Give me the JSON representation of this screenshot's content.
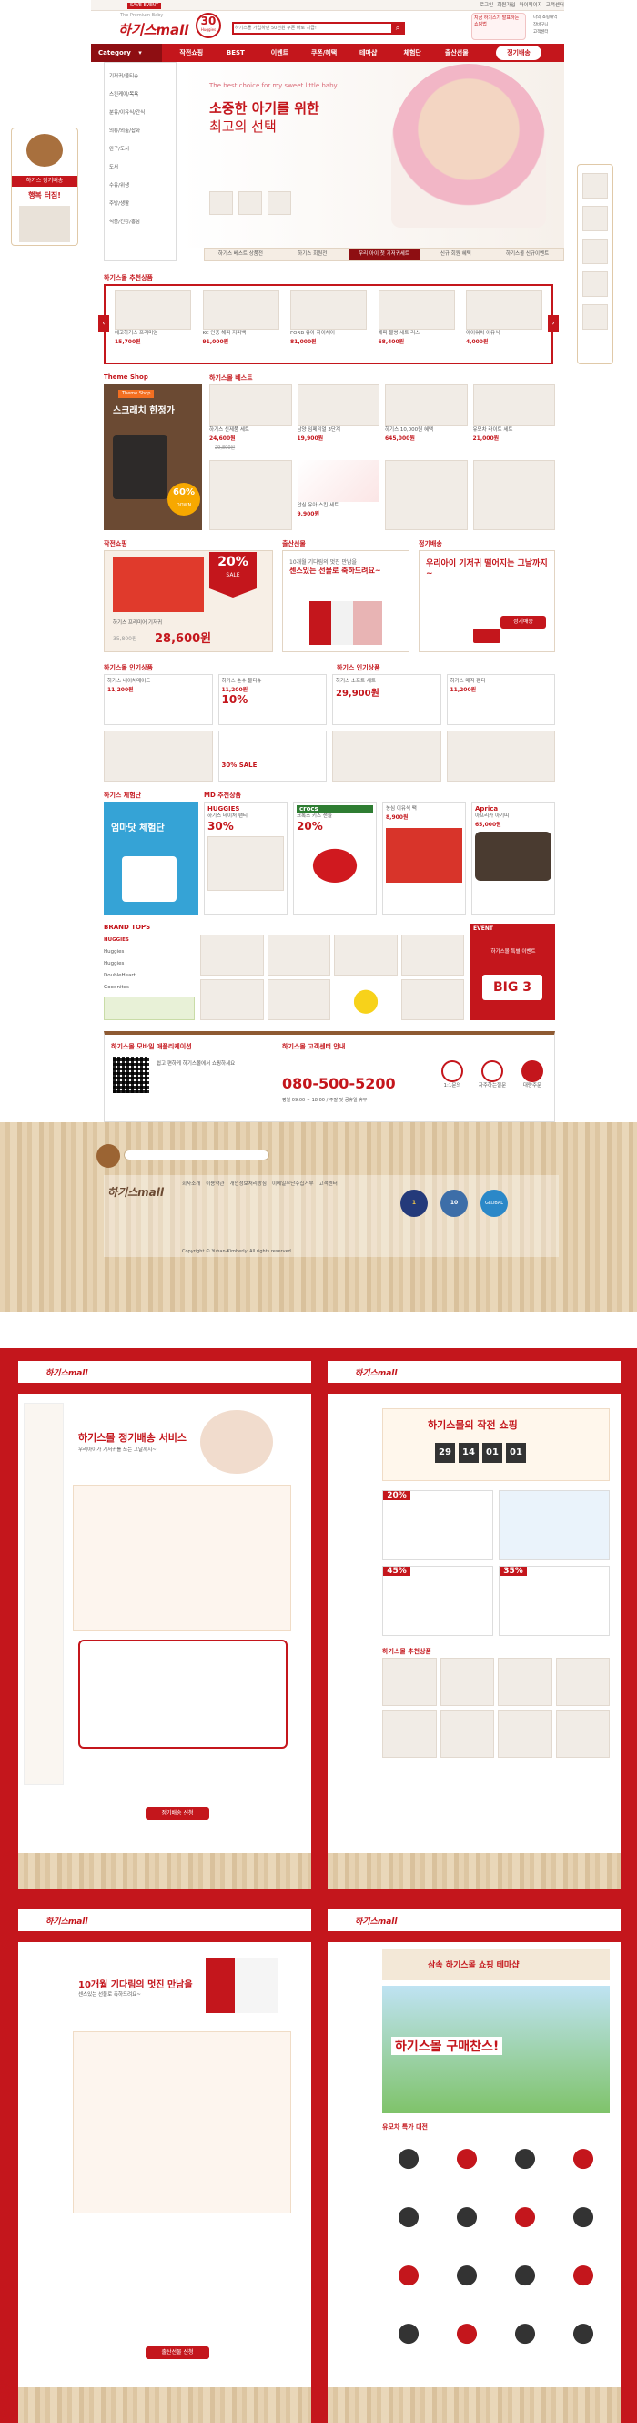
{
  "topbar": {
    "links": [
      "로그인",
      "회원가입",
      "마이페이지",
      "고객센터"
    ],
    "promo_tag": "SAVE EVENT"
  },
  "header": {
    "logo": "하기스mall",
    "logo_sub": "The Premium Baby",
    "anniv": "30",
    "anniv_sub": "Huggies",
    "search_placeholder": "하기스몰 가입하면 50천원 쿠폰 바로 지급!",
    "right_links": [
      "나의 쇼핑내역",
      "장바구니",
      "고객센터"
    ],
    "side_badge": "지금 하기스가 발표하는 쇼핑법"
  },
  "nav": {
    "category_label": "Category",
    "items": [
      "작전쇼핑",
      "BEST",
      "이벤트",
      "쿠폰/혜택",
      "테마샵",
      "체험단",
      "출산선물"
    ],
    "special": "정기배송"
  },
  "category_menu": [
    "기저귀/물티슈",
    "스킨케어/목욕",
    "분유/이유식/간식",
    "의류/외출/잡화",
    "완구/도서",
    "도서",
    "수유/위생",
    "주방/생활",
    "식품/건강/홍삼"
  ],
  "hero": {
    "eng": "The best choice for my sweet little baby",
    "title1": "소중한 아기를 위한",
    "title2": "최고의 선택",
    "tabs": [
      "하기스 베스트 상품전",
      "하기스 회원전",
      "우리 아이 첫 기저귀세트",
      "신규 회원 혜택",
      "하기스몰 신규이벤트"
    ]
  },
  "left_banner": {
    "title": "하기스 정기배송",
    "sub": "행복 터짐!"
  },
  "rec": {
    "title": "하기스몰 추천상품",
    "items": [
      {
        "name": "에코하기스 프리미엄",
        "price": "15,700원"
      },
      {
        "name": "KC 인증 해피 지퍼백",
        "price": "91,000원"
      },
      {
        "name": "FORB 유아 하이체어",
        "price": "81,000원"
      },
      {
        "name": "해피 물병 세트 리스",
        "price": "68,400원"
      },
      {
        "name": "아이워치 이유식",
        "price": "4,000원"
      }
    ]
  },
  "theme": {
    "title": "Theme Shop",
    "badge": "스크래치 한정가",
    "sub": "스크래치 한정가",
    "pct": "60%",
    "pct_sub": "DOWN"
  },
  "best": {
    "title": "하기스몰 베스트",
    "items": [
      {
        "name": "하기스 신제품 세트",
        "price": "24,600원",
        "old": "29,800원"
      },
      {
        "name": "남양 임페리얼 3단계",
        "price": "19,900원"
      },
      {
        "name": "하기스 10,000원 혜택",
        "price": "645,000원"
      },
      {
        "name": "유모차 라이트 세트",
        "price": "21,000원"
      },
      {
        "name": "안심 유아 스킨 세트",
        "price": "9,900원"
      }
    ]
  },
  "midrow": {
    "left": "작전쇼핑",
    "mid": "출산선물",
    "right": "정기배송"
  },
  "sale": {
    "pct": "20%",
    "word": "SALE",
    "price": "28,600원",
    "old": "35,800원",
    "name": "하기스 프리미어 기저귀"
  },
  "gift": {
    "line1": "10개월 기다림의 멋진 만남을",
    "line2": "센스있는 선물로 축하드려요~"
  },
  "regular": {
    "line1": "우리아이 기저귀 떨어지는 그날까지~",
    "line2": "",
    "btn": "정기배송"
  },
  "hot": {
    "title": "하기스몰 인기상품",
    "items": [
      {
        "name": "하기스 네이처메이드",
        "price": "11,200원"
      },
      {
        "name": "하기스 순수 물티슈",
        "price": "11,200원",
        "pct": "10%"
      },
      {
        "name": "하기스 소프트 세트",
        "price": "29,900원"
      },
      {
        "name": "하기스 매직 팬티",
        "price": "11,200원"
      }
    ]
  },
  "cheap": {
    "title": "하기스 인기상품",
    "pct": "30%",
    "label": "30% SALE"
  },
  "exp": {
    "title": "하기스 체험단",
    "badge": "엄마닷 체험단",
    "title2": "MD 추천상품",
    "brands": [
      "HUGGIES",
      "crocs",
      "Aprica"
    ],
    "items": [
      {
        "name": "하기스 네이처 팬티",
        "price": "30%"
      },
      {
        "name": "크록스 키즈 샌들",
        "price": "20%"
      },
      {
        "name": "농심 이유식 팩",
        "price": "8,900원"
      },
      {
        "name": "아프리카 아기띠",
        "price": "65,000원"
      }
    ]
  },
  "brand": {
    "title": "BRAND TOPS",
    "brands": [
      "HUGGIES",
      "Huggies",
      "Huggies",
      "DoubleHeart",
      "Goodnites"
    ],
    "event_title": "EVENT",
    "event_badge": "BIG 3",
    "event_sub": "하기스몰 특별 이벤트"
  },
  "app": {
    "title": "하기스몰 모바일 애플리케이션",
    "desc": "쉽고 편하게 하기스몰에서 쇼핑하세요",
    "qr": "QR"
  },
  "cs": {
    "title": "하기스몰 고객센터 안내",
    "phone": "080-500-5200",
    "hours": "평일 09:00 ~ 18:00 / 주말 및 공휴일 휴무",
    "icons": [
      "1:1문의",
      "자주하는질문",
      "대량주문"
    ]
  },
  "footer": {
    "logo": "하기스mall",
    "links": [
      "회사소개",
      "이용약관",
      "개인정보처리방침",
      "이메일무단수집거부",
      "고객센터"
    ],
    "marks": [
      "1",
      "10",
      "GLOBAL"
    ],
    "copyright": "Copyright © Yuhan-Kimberly. All rights reserved."
  },
  "page2": {
    "title": "하기스몰 정기배송 서비스",
    "sub": "우리아이가 기저귀를 쓰는 그날까지~",
    "btn": "정기배송 신청"
  },
  "page3": {
    "title": "하기스몰의 작전 쇼핑",
    "time": [
      "29",
      "14",
      "01",
      "01"
    ],
    "pct1": "20%",
    "pct2": "45%",
    "pct3": "35%",
    "sub": "하기스몰 추천상품"
  },
  "page4": {
    "title": "10개월 기다림의 멋진 만남을",
    "sub": "센스있는 선물로 축하드려요~",
    "btn": "출산선물 신청"
  },
  "page5": {
    "title": "삼속 하기스몰 쇼핑 테마샵",
    "banner": "하기스몰 구매찬스!",
    "sub": "유모차 특가 대전"
  }
}
